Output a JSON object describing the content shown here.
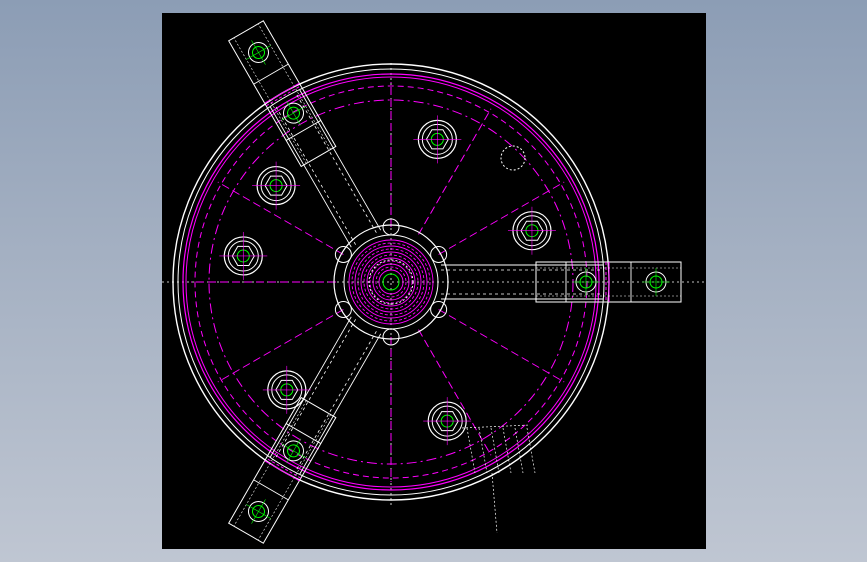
{
  "drawing": {
    "subject": "three-jaw-chuck-front-view",
    "background_color": "#000000",
    "window_background": "#9aa8bc",
    "colors": {
      "outline": "#ffffff",
      "center_line": "#ff00ff",
      "hole": "#00ff00",
      "hidden_line": "#ffffff"
    },
    "jaw_count": 3,
    "jaw_angles_deg": [
      0,
      120,
      240
    ],
    "bolt_count": 6,
    "bolt_angles_deg": [
      20,
      72,
      140,
      170,
      226,
      292
    ]
  }
}
